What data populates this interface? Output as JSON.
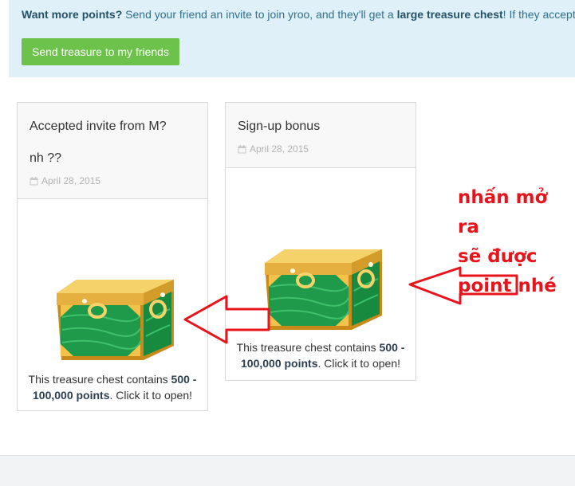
{
  "banner": {
    "lead": "Want more points?",
    "text_1": " Send your friend an invite to join yroo, and they'll get a ",
    "highlight": "large treasure chest",
    "text_2": "! If they accept",
    "button_label": "Send treasure to my friends"
  },
  "cards": [
    {
      "title": "Accepted invite from M?",
      "subtitle": "nh ??",
      "date": "April 28, 2015",
      "caption_pre": "This treasure chest contains ",
      "caption_bold": "500 - 100,000 points",
      "caption_post": ". Click it to open!"
    },
    {
      "title": "Sign-up bonus",
      "date": "April 28, 2015",
      "caption_pre": "This treasure chest contains ",
      "caption_bold": "500 - 100,000 points",
      "caption_post": ". Click it to open!"
    }
  ],
  "annotation": {
    "line1": "nhấn mở ra",
    "line2": "sẽ được",
    "line3": "point nhé"
  },
  "colors": {
    "banner_bg": "#dff0f8",
    "button": "#6cc24a",
    "annotation": "#e8141b",
    "chest_green": "#1f9a4a",
    "chest_gold": "#f2c24a"
  },
  "icons": [
    "calendar-icon",
    "treasure-chest-icon",
    "arrow-left-icon"
  ]
}
